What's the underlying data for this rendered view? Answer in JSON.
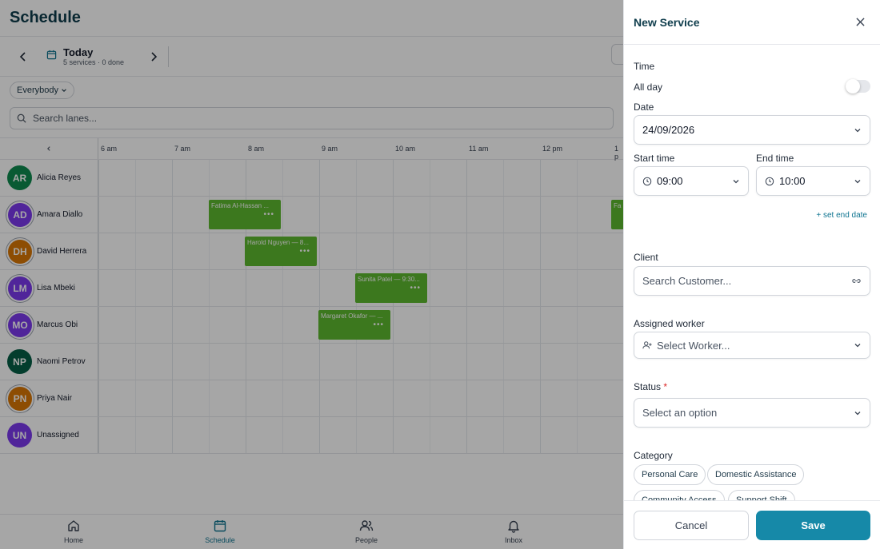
{
  "app": {
    "title": "Schedule",
    "date_title": "Today",
    "date_sub": "5 services · 0 done",
    "filter_label": "Everybody",
    "search_placeholder": "Search lanes..."
  },
  "hours": [
    "6 am",
    "7 am",
    "8 am",
    "9 am",
    "10 am",
    "11 am",
    "12 pm",
    "1 p"
  ],
  "lanes": [
    {
      "initials": "AR",
      "name": "Alicia Reyes",
      "color": "#0f8a4f",
      "ring": false
    },
    {
      "initials": "AD",
      "name": "Amara Diallo",
      "color": "#7c3aed",
      "ring": true
    },
    {
      "initials": "DH",
      "name": "David Herrera",
      "color": "#d97706",
      "ring": true
    },
    {
      "initials": "LM",
      "name": "Lisa Mbeki",
      "color": "#7c3aed",
      "ring": true
    },
    {
      "initials": "MO",
      "name": "Marcus Obi",
      "color": "#7c3aed",
      "ring": true
    },
    {
      "initials": "NP",
      "name": "Naomi Petrov",
      "color": "#065f46",
      "ring": false
    },
    {
      "initials": "PN",
      "name": "Priya Nair",
      "color": "#d97706",
      "ring": true
    },
    {
      "initials": "UN",
      "name": "Unassigned",
      "color": "#7c3aed",
      "ring": false
    }
  ],
  "events": [
    {
      "lane": 1,
      "label": "Fatima Al-Hassan ..."
    },
    {
      "lane": 1,
      "label": "Fa"
    },
    {
      "lane": 2,
      "label": "Harold Nguyen — 8..."
    },
    {
      "lane": 3,
      "label": "Sunita Patel — 9:30..."
    },
    {
      "lane": 4,
      "label": "Margaret Okafor — ..."
    }
  ],
  "bottom_nav": [
    {
      "label": "Home",
      "icon": "home-icon",
      "active": false
    },
    {
      "label": "Schedule",
      "icon": "calendar-icon",
      "active": true
    },
    {
      "label": "People",
      "icon": "people-icon",
      "active": false
    },
    {
      "label": "Inbox",
      "icon": "bell-icon",
      "active": false
    }
  ],
  "panel": {
    "title": "New Service",
    "time_label": "Time",
    "allday_label": "All day",
    "allday_on": false,
    "date_label": "Date",
    "date_value": "24/09/2026",
    "start_label": "Start time",
    "start_value": "09:00",
    "end_label": "End time",
    "end_value": "10:00",
    "end_date_link": "+ set end date",
    "client_label": "Client",
    "client_placeholder": "Search Customer...",
    "worker_label": "Assigned worker",
    "worker_placeholder": "Select Worker...",
    "status_label": "Status",
    "status_required": "*",
    "status_placeholder": "Select an option",
    "category_label": "Category",
    "categories": [
      "Personal Care",
      "Domestic Assistance",
      "Community Access",
      "Support Shift"
    ],
    "cancel_label": "Cancel",
    "save_label": "Save",
    "accent": "#1689a8"
  }
}
